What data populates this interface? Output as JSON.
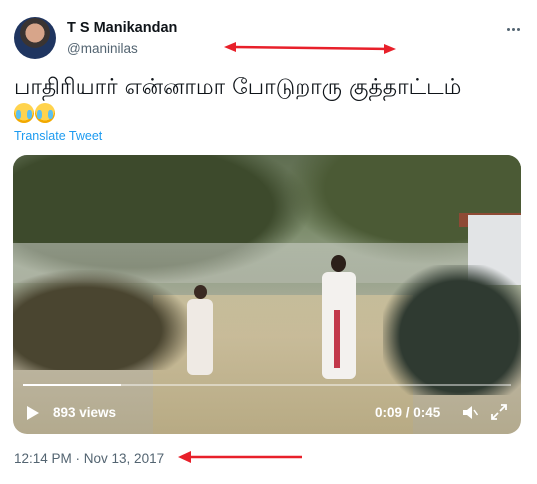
{
  "tweet": {
    "author_name": "T S Manikandan",
    "author_handle": "@maninilas",
    "text": "பாதிரியார் என்னாமா போடுறாரு குத்தாட்டம்",
    "emoji": "😹😹",
    "translate_label": "Translate Tweet",
    "timestamp": "12:14 PM · Nov 13, 2017"
  },
  "video": {
    "views": "893 views",
    "time": "0:09 / 0:45",
    "progress": 0.2
  },
  "annotations": {
    "arrow_color": "#e8202a"
  },
  "icons": [
    "more-icon",
    "play-icon",
    "mute-icon",
    "fullscreen-icon",
    "emoji-icon"
  ],
  "colors": {
    "link": "#1d9bf0",
    "secondary_text": "#536471",
    "primary_text": "#0f1419"
  }
}
